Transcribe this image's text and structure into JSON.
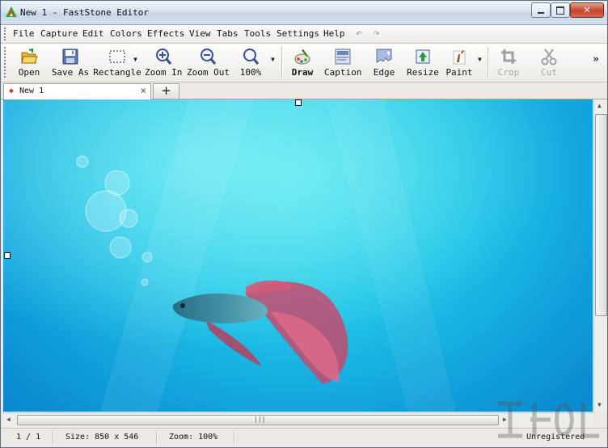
{
  "window": {
    "title": "New 1 - FastStone Editor"
  },
  "menu": [
    "File",
    "Capture",
    "Edit",
    "Colors",
    "Effects",
    "View",
    "Tabs",
    "Tools",
    "Settings",
    "Help"
  ],
  "toolbar": {
    "open": "Open",
    "save_as": "Save As",
    "rectangle": "Rectangle",
    "zoom_in": "Zoom In",
    "zoom_out": "Zoom Out",
    "zoom_level": "100%",
    "draw": "Draw",
    "caption": "Caption",
    "edge": "Edge",
    "resize": "Resize",
    "paint": "Paint",
    "crop": "Crop",
    "cut": "Cut"
  },
  "tabs": [
    {
      "label": "New 1",
      "active": true
    }
  ],
  "status": {
    "page": "1 / 1",
    "size": "Size: 850 x 546",
    "zoom": "Zoom: 100%",
    "registration": "Unregistered"
  },
  "colors": {
    "canvas_light": "#52e3ee",
    "canvas_dark": "#0b86cd",
    "close_button": "#c7432b"
  }
}
